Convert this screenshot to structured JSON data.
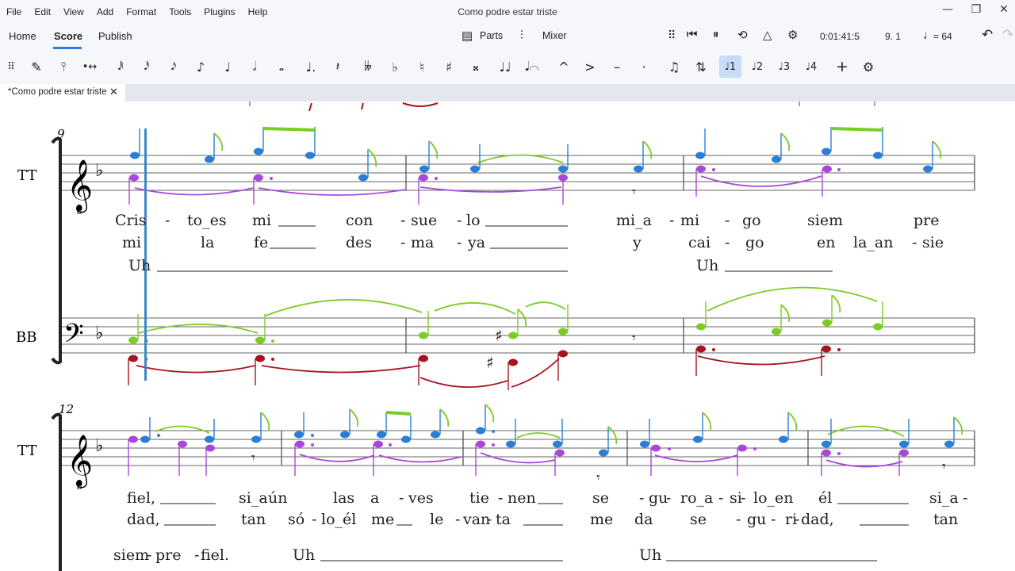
{
  "menu": {
    "items": [
      "File",
      "Edit",
      "View",
      "Add",
      "Format",
      "Tools",
      "Plugins",
      "Help"
    ],
    "window_title": "Como podre estar triste"
  },
  "toolbar": {
    "workspaces": [
      "Home",
      "Score",
      "Publish"
    ],
    "active_workspace": "Score",
    "parts_label": "Parts",
    "mixer_label": "Mixer",
    "time": "0:01:41:5",
    "position": "9. 1",
    "tempo": "= 64"
  },
  "palette": {
    "selected_voice": "voice-1"
  },
  "document": {
    "tab_label": "*Como podre estar triste"
  },
  "score": {
    "system1": {
      "measure_number": "9",
      "staff1_label": "TT",
      "staff2_label": "BB",
      "lyrics_v1": [
        "Cris",
        "-",
        "to_es",
        "mi",
        "con",
        "-",
        "sue",
        "-",
        "lo",
        "mi_a",
        "-",
        "mi",
        "-",
        "go",
        "siem",
        "pre"
      ],
      "lyrics_v2": [
        "mi",
        "la",
        "fe",
        "des",
        "-",
        "ma",
        "-",
        "ya",
        "y",
        "cai",
        "-",
        "go",
        "en",
        "la_an",
        "-",
        "sie"
      ],
      "lyrics_v3": [
        "Uh",
        "Uh"
      ]
    },
    "system2": {
      "measure_number": "12",
      "staff1_label": "TT",
      "lyrics_v1": [
        "fiel,",
        "si_a",
        "-",
        "ún",
        "las",
        "a",
        "-",
        "ves",
        "tie",
        "-",
        "nen",
        "se",
        "-",
        "gu",
        "-",
        "ro_a",
        "-",
        "si",
        "-",
        "lo_en",
        "él",
        "si_a",
        "-"
      ],
      "lyrics_v2": [
        "dad,",
        "tan",
        "só",
        "-",
        "lo_él",
        "me",
        "le",
        "-",
        "van",
        "-",
        "ta",
        "me",
        "da",
        "se",
        "-",
        "gu",
        "-",
        "ri",
        "-",
        "dad,",
        "tan"
      ],
      "lyrics_v3": [
        "siem",
        "-",
        "pre",
        "-",
        "fiel.",
        "Uh",
        "Uh"
      ]
    }
  },
  "colors": {
    "voice1": "#2a7fd4",
    "voice2": "#a848d8",
    "voice3": "#7bcc23",
    "voice4": "#a8141e",
    "playhead": "#3d87c8",
    "accent": "#2f7de1"
  }
}
